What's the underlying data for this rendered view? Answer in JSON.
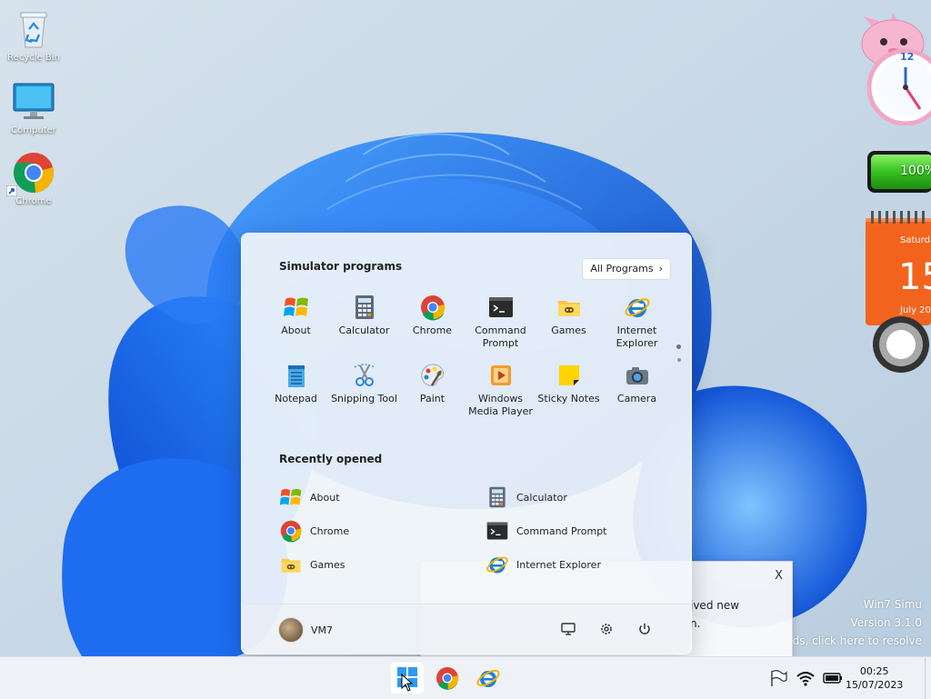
{
  "desktop": {
    "icons": [
      {
        "label": "Recycle Bin",
        "icon": "recycle-bin-icon"
      },
      {
        "label": "Computer",
        "icon": "computer-icon"
      },
      {
        "label": "Chrome",
        "icon": "chrome-icon"
      }
    ]
  },
  "gadgets": {
    "clock": {
      "number_12": "12"
    },
    "battery": {
      "level_text": "100%",
      "level": 1.0
    },
    "calendar": {
      "day": "Saturday",
      "date": "15",
      "month_year": "July 20"
    }
  },
  "start_menu": {
    "pinned_title": "Simulator programs",
    "all_programs_label": "All Programs",
    "pinned": [
      {
        "label": "About",
        "icon": "windows-flag-icon"
      },
      {
        "label": "Calculator",
        "icon": "calculator-icon"
      },
      {
        "label": "Chrome",
        "icon": "chrome-icon"
      },
      {
        "label": "Command Prompt",
        "icon": "command-prompt-icon"
      },
      {
        "label": "Games",
        "icon": "games-folder-icon"
      },
      {
        "label": "Internet Explorer",
        "icon": "internet-explorer-icon"
      },
      {
        "label": "Notepad",
        "icon": "notepad-icon"
      },
      {
        "label": "Snipping Tool",
        "icon": "snipping-tool-icon"
      },
      {
        "label": "Paint",
        "icon": "paint-icon"
      },
      {
        "label": "Windows Media Player",
        "icon": "media-player-icon"
      },
      {
        "label": "Sticky Notes",
        "icon": "sticky-notes-icon"
      },
      {
        "label": "Camera",
        "icon": "camera-icon"
      }
    ],
    "recent_title": "Recently opened",
    "recent": [
      {
        "label": "About",
        "icon": "windows-flag-icon"
      },
      {
        "label": "Calculator",
        "icon": "calculator-icon"
      },
      {
        "label": "Chrome",
        "icon": "chrome-icon"
      },
      {
        "label": "Command Prompt",
        "icon": "command-prompt-icon"
      },
      {
        "label": "Games",
        "icon": "games-folder-icon"
      },
      {
        "label": "Internet Explorer",
        "icon": "internet-explorer-icon"
      }
    ],
    "user_name": "VM7"
  },
  "notification": {
    "close_label": "X",
    "text_line1": "ived new",
    "text_line2": "n."
  },
  "watermark": {
    "line1": "Win7 Simu",
    "line2": "Version 3.1.0",
    "line3": "ads, click here to resolve"
  },
  "taskbar": {
    "time": "00:25",
    "date": "15/07/2023"
  },
  "colors": {
    "accent_blue": "#1565e8",
    "start_bg": "#f2f6fa",
    "calendar_orange": "#f2641e",
    "battery_green": "#35c21f"
  }
}
